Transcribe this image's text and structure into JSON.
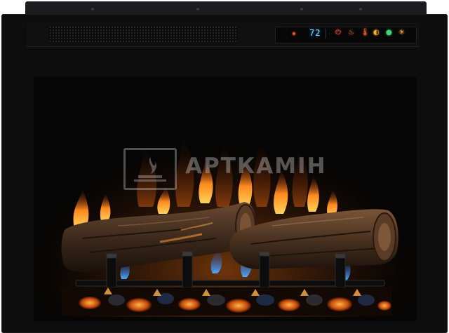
{
  "control_panel": {
    "temperature": "72",
    "indicator_color": "#ff4a2a",
    "display_color": "#7fd6ff",
    "controls": [
      {
        "icon": "power-icon",
        "glyph": "⏻",
        "color": "#ff5a3a"
      },
      {
        "icon": "flame-icon",
        "glyph": "♨",
        "color": "#ff7a30"
      },
      {
        "icon": "heat-icon",
        "glyph": "🌡",
        "color": "#ff6a30"
      },
      {
        "icon": "brightness-icon",
        "glyph": "◐",
        "color": "#ffb030"
      },
      {
        "icon": "color-palette-icon",
        "glyph": "●",
        "color": "#3ed27a"
      },
      {
        "icon": "sun-icon",
        "glyph": "☀",
        "color": "#ff9a30"
      }
    ]
  },
  "watermark": {
    "text": "АРТКАМІН"
  }
}
